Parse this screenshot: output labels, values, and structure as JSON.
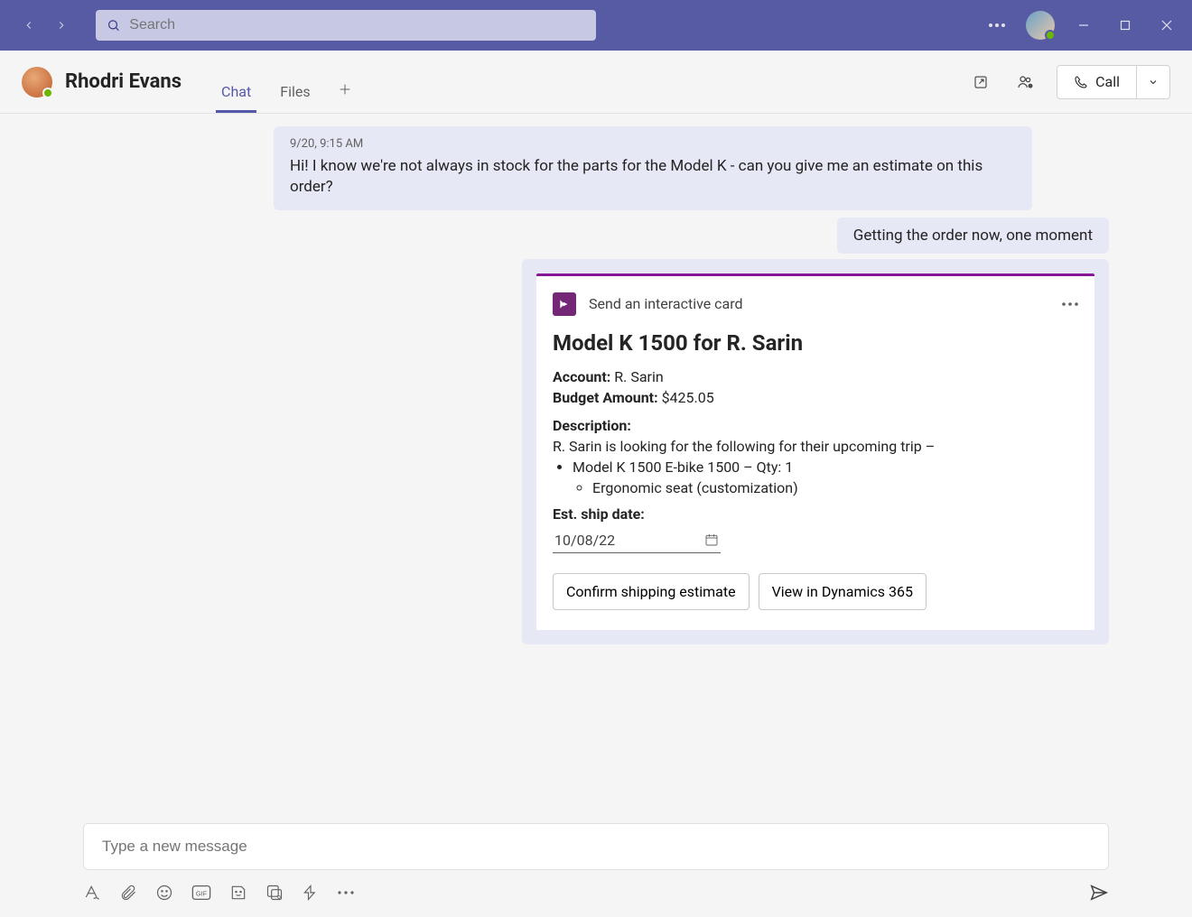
{
  "titlebar": {
    "search_placeholder": "Search"
  },
  "chat": {
    "title": "Rhodri Evans",
    "tabs": [
      "Chat",
      "Files"
    ],
    "active_tab": 0,
    "call_label": "Call"
  },
  "messages": {
    "incoming_time": "9/20, 9:15 AM",
    "incoming_text": "Hi! I know we're not always in stock for the parts for the Model K - can you give me an estimate on this order?",
    "outgoing_text": "Getting the order now, one moment"
  },
  "card": {
    "app_title": "Send an interactive card",
    "title": "Model K 1500 for R. Sarin",
    "account_label": "Account:",
    "account_value": "R. Sarin",
    "budget_label": "Budget Amount:",
    "budget_value": "$425.05",
    "description_label": "Description:",
    "description_text": "R. Sarin is looking for the following for their upcoming trip –",
    "item1": "Model K 1500 E-bike 1500 – Qty: 1",
    "item1a": "Ergonomic seat (customization)",
    "ship_label": "Est. ship date:",
    "ship_value": "10/08/22",
    "btn_confirm": "Confirm shipping estimate",
    "btn_view": "View in Dynamics 365"
  },
  "compose": {
    "placeholder": "Type a new message"
  }
}
